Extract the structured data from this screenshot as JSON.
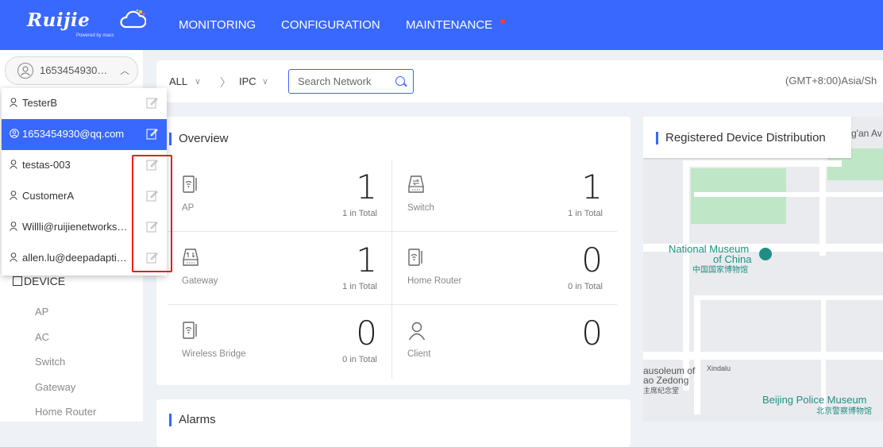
{
  "brand": {
    "logo_text": "Ruijie",
    "logo_sub": "Powered by macc"
  },
  "nav": {
    "monitoring": "MONITORING",
    "configuration": "CONFIGURATION",
    "maintenance": "MAINTENANCE"
  },
  "colors": {
    "accent": "#3968ff",
    "alert_dot": "#ff3b3b",
    "highlight": "#e81e1e",
    "map_green": "#bfe6c6"
  },
  "account": {
    "current": "1653454930…",
    "chevron_icon": "chevron-up-icon"
  },
  "accounts_dropdown": [
    {
      "name": "TesterB",
      "icon": "user-icon",
      "active": false
    },
    {
      "name": "1653454930@qq.com",
      "icon": "admin-user-icon",
      "active": true
    },
    {
      "name": "testas-003",
      "icon": "user-icon",
      "active": false
    },
    {
      "name": "CustomerA",
      "icon": "user-icon",
      "active": false
    },
    {
      "name": "Willli@ruijienetworks…",
      "icon": "user-icon",
      "active": false
    },
    {
      "name": "allen.lu@deepadapti…",
      "icon": "user-icon",
      "active": false
    }
  ],
  "sidebar": {
    "section": "DEVICE",
    "items": [
      "AP",
      "AC",
      "Switch",
      "Gateway",
      "Home Router"
    ]
  },
  "toolbar": {
    "scope": "ALL",
    "network": "IPC",
    "search_placeholder": "Search Network",
    "timezone": "(GMT+8:00)Asia/Sh"
  },
  "overview": {
    "title": "Overview",
    "cells": [
      {
        "label": "AP",
        "value": "1",
        "total": "1 in Total",
        "icon": "ap-icon"
      },
      {
        "label": "Switch",
        "value": "1",
        "total": "1 in Total",
        "icon": "switch-icon"
      },
      {
        "label": "Gateway",
        "value": "1",
        "total": "1 in Total",
        "icon": "gateway-icon"
      },
      {
        "label": "Home Router",
        "value": "0",
        "total": "0 in Total",
        "icon": "home-router-icon"
      },
      {
        "label": "Wireless Bridge",
        "value": "0",
        "total": "0 in Total",
        "icon": "wireless-bridge-icon"
      },
      {
        "label": "Client",
        "value": "0",
        "total": "",
        "icon": "client-icon"
      }
    ]
  },
  "alarms": {
    "title": "Alarms"
  },
  "map": {
    "title": "Registered Device Distribution",
    "labels": {
      "avenue": "g'an Av",
      "museum_en1": "National Museum",
      "museum_en2": "of China",
      "museum_cn": "中国国家博物馆",
      "mausoleum_en1": "ausoleum of",
      "mausoleum_en2": "ao Zedong",
      "mausoleum_cn": "主席纪念堂",
      "xindalu": "Xindalu",
      "police_en": "Beijing Police Museum",
      "police_cn": "北京警察博物馆"
    }
  }
}
